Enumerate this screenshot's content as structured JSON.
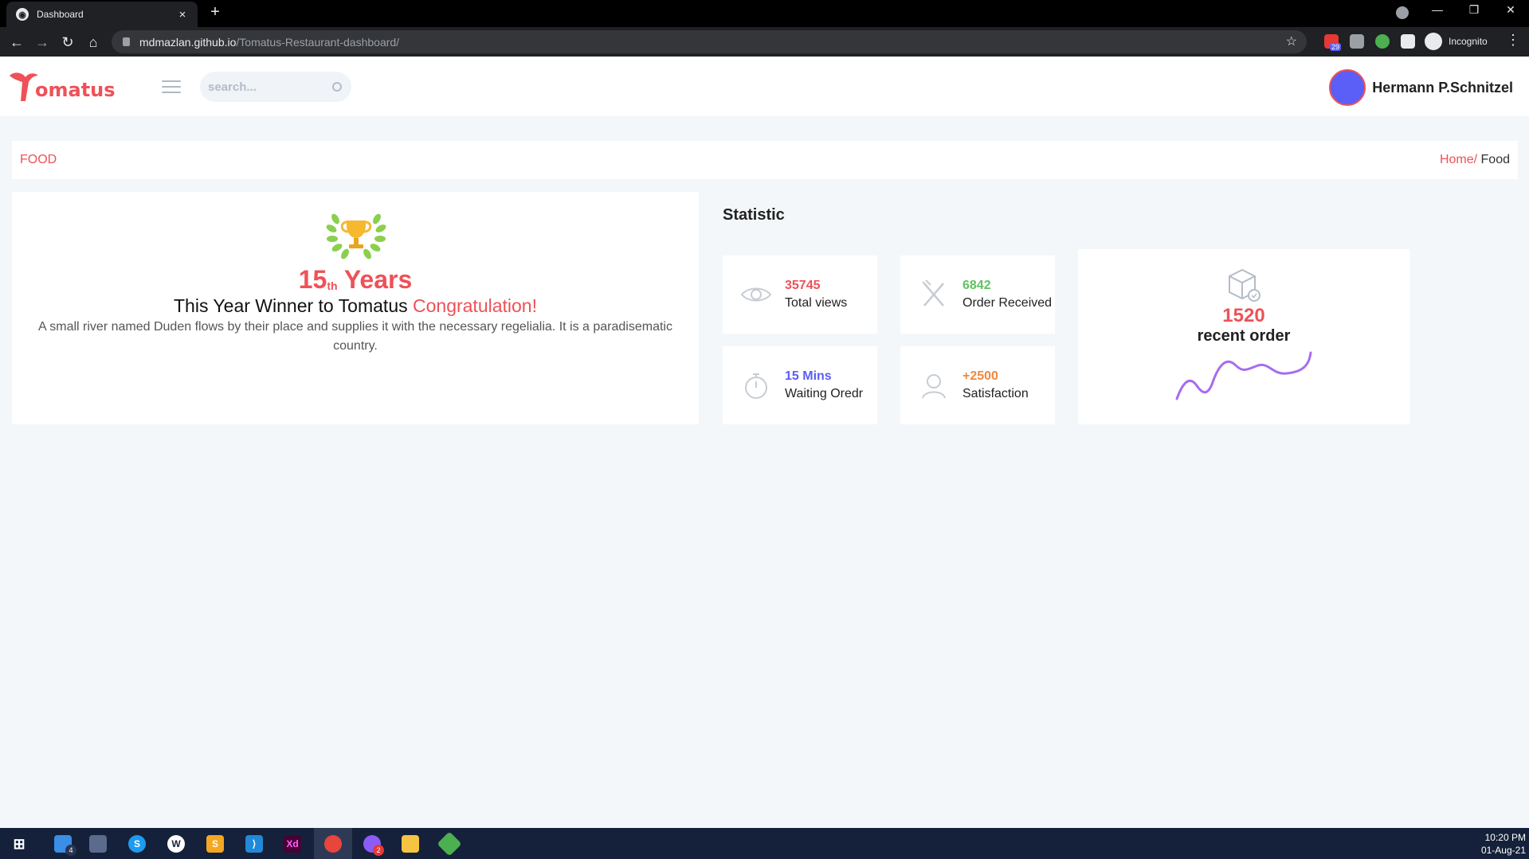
{
  "browser": {
    "tab_title": "Dashboard",
    "tab_close": "×",
    "new_tab": "+",
    "url_host": "mdmazlan.github.io",
    "url_path": "/Tomatus-Restaurant-dashboard/",
    "incognito_label": "Incognito",
    "extension_badge": "29"
  },
  "header": {
    "logo_text": "omatus",
    "search_placeholder": "search...",
    "user_name": "Hermann P.Schnitzel"
  },
  "breadcrumb": {
    "title": "FOOD",
    "home": "Home/",
    "current": " Food"
  },
  "winner": {
    "years_number": "15",
    "years_suffix": "th",
    "years_word": " Years",
    "line_prefix": "This Year Winner to Tomatus ",
    "line_highlight": "Congratulation!",
    "description": "A small river named Duden flows by their place and supplies it with the necessary regelialia. It is a paradisematic country."
  },
  "statistic": {
    "heading": "Statistic",
    "cards": [
      {
        "value": "35745",
        "label": "Total views",
        "icon": "eye-icon",
        "color": "#ee5157"
      },
      {
        "value": "6842",
        "label": "Order Received",
        "icon": "fork-knife-icon",
        "color": "#5fc45f"
      },
      {
        "value": "15 Mins",
        "label": "Waiting Oredr",
        "icon": "stopwatch-icon",
        "color": "#5b5ef7"
      },
      {
        "value": "+2500",
        "label": "Satisfaction",
        "icon": "user-icon",
        "color": "#f0883e"
      }
    ],
    "recent": {
      "value": "1520",
      "label": "recent order",
      "icon": "delivery-box-icon"
    }
  },
  "taskbar": {
    "time": "10:20 PM",
    "date": "01-Aug-21",
    "badge_explorer": "4",
    "badge_messenger": "2"
  },
  "colors": {
    "accent": "#ee5157",
    "green": "#5fc45f",
    "blue": "#5b5ef7",
    "orange": "#f0883e",
    "sparkline": "#a66cf0"
  }
}
